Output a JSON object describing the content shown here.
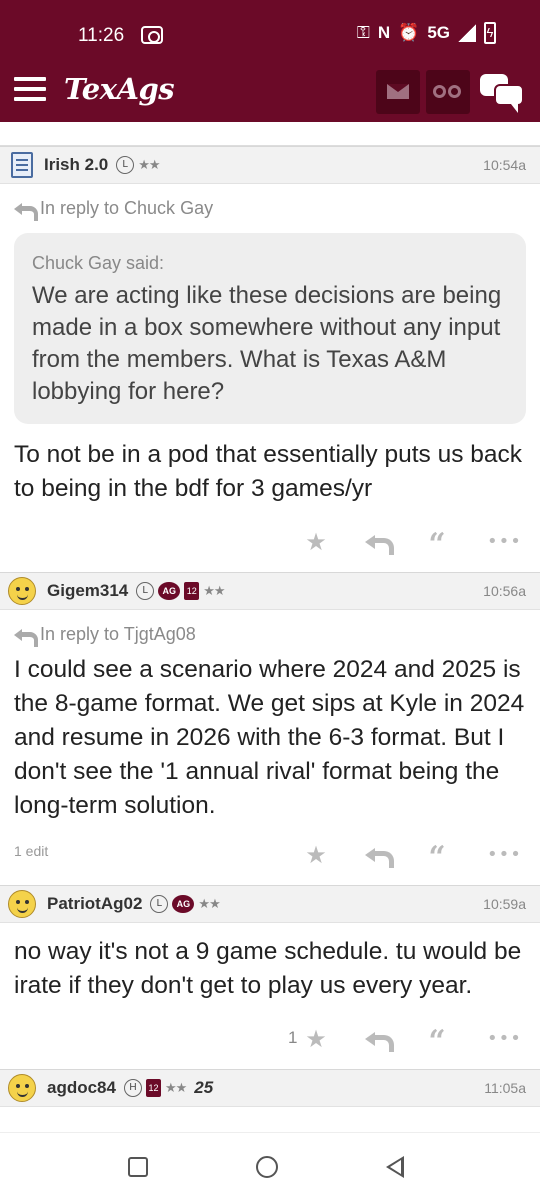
{
  "status_bar": {
    "time": "11:26",
    "network": "5G"
  },
  "header": {
    "logo": "TexAgs",
    "colors": {
      "maroon": "#6b0a28",
      "maroon_dark": "#4d0519"
    }
  },
  "posts": [
    {
      "username": "Irish 2.0",
      "badges": [
        "L"
      ],
      "stars": "★★",
      "time": "10:54a",
      "reply_to": "In reply to Chuck Gay",
      "quote_author": "Chuck Gay said:",
      "quote_text": "We are acting like these decisions are being made in a box somewhere without any input from the members. What is Texas A&M lobbying for here?",
      "body": "To not be in a pod that essentially puts us back to being in the bdf for 3 games/yr",
      "like_count": "",
      "edit_note": ""
    },
    {
      "username": "Gigem314",
      "badges": [
        "L",
        "AG",
        "12"
      ],
      "stars": "★★",
      "time": "10:56a",
      "reply_to": "In reply to TjgtAg08",
      "body": "I could see a scenario where 2024 and 2025 is the 8-game format. We get sips at Kyle in 2024 and resume in 2026 with the 6-3 format. But I don't see the '1 annual rival' format being the long-term solution.",
      "like_count": "",
      "edit_note": "1 edit"
    },
    {
      "username": "PatriotAg02",
      "badges": [
        "L",
        "AG"
      ],
      "stars": "★★",
      "time": "10:59a",
      "body": "no way it's not a 9 game schedule. tu would be irate if they don't get to play us every year.",
      "like_count": "1",
      "edit_note": ""
    },
    {
      "username": "agdoc84",
      "badges": [
        "H",
        "12"
      ],
      "stars": "★★",
      "extra_badge": "25",
      "time": "11:05a"
    }
  ],
  "icons": {
    "star": "★",
    "quote": "“",
    "more": "•••"
  }
}
